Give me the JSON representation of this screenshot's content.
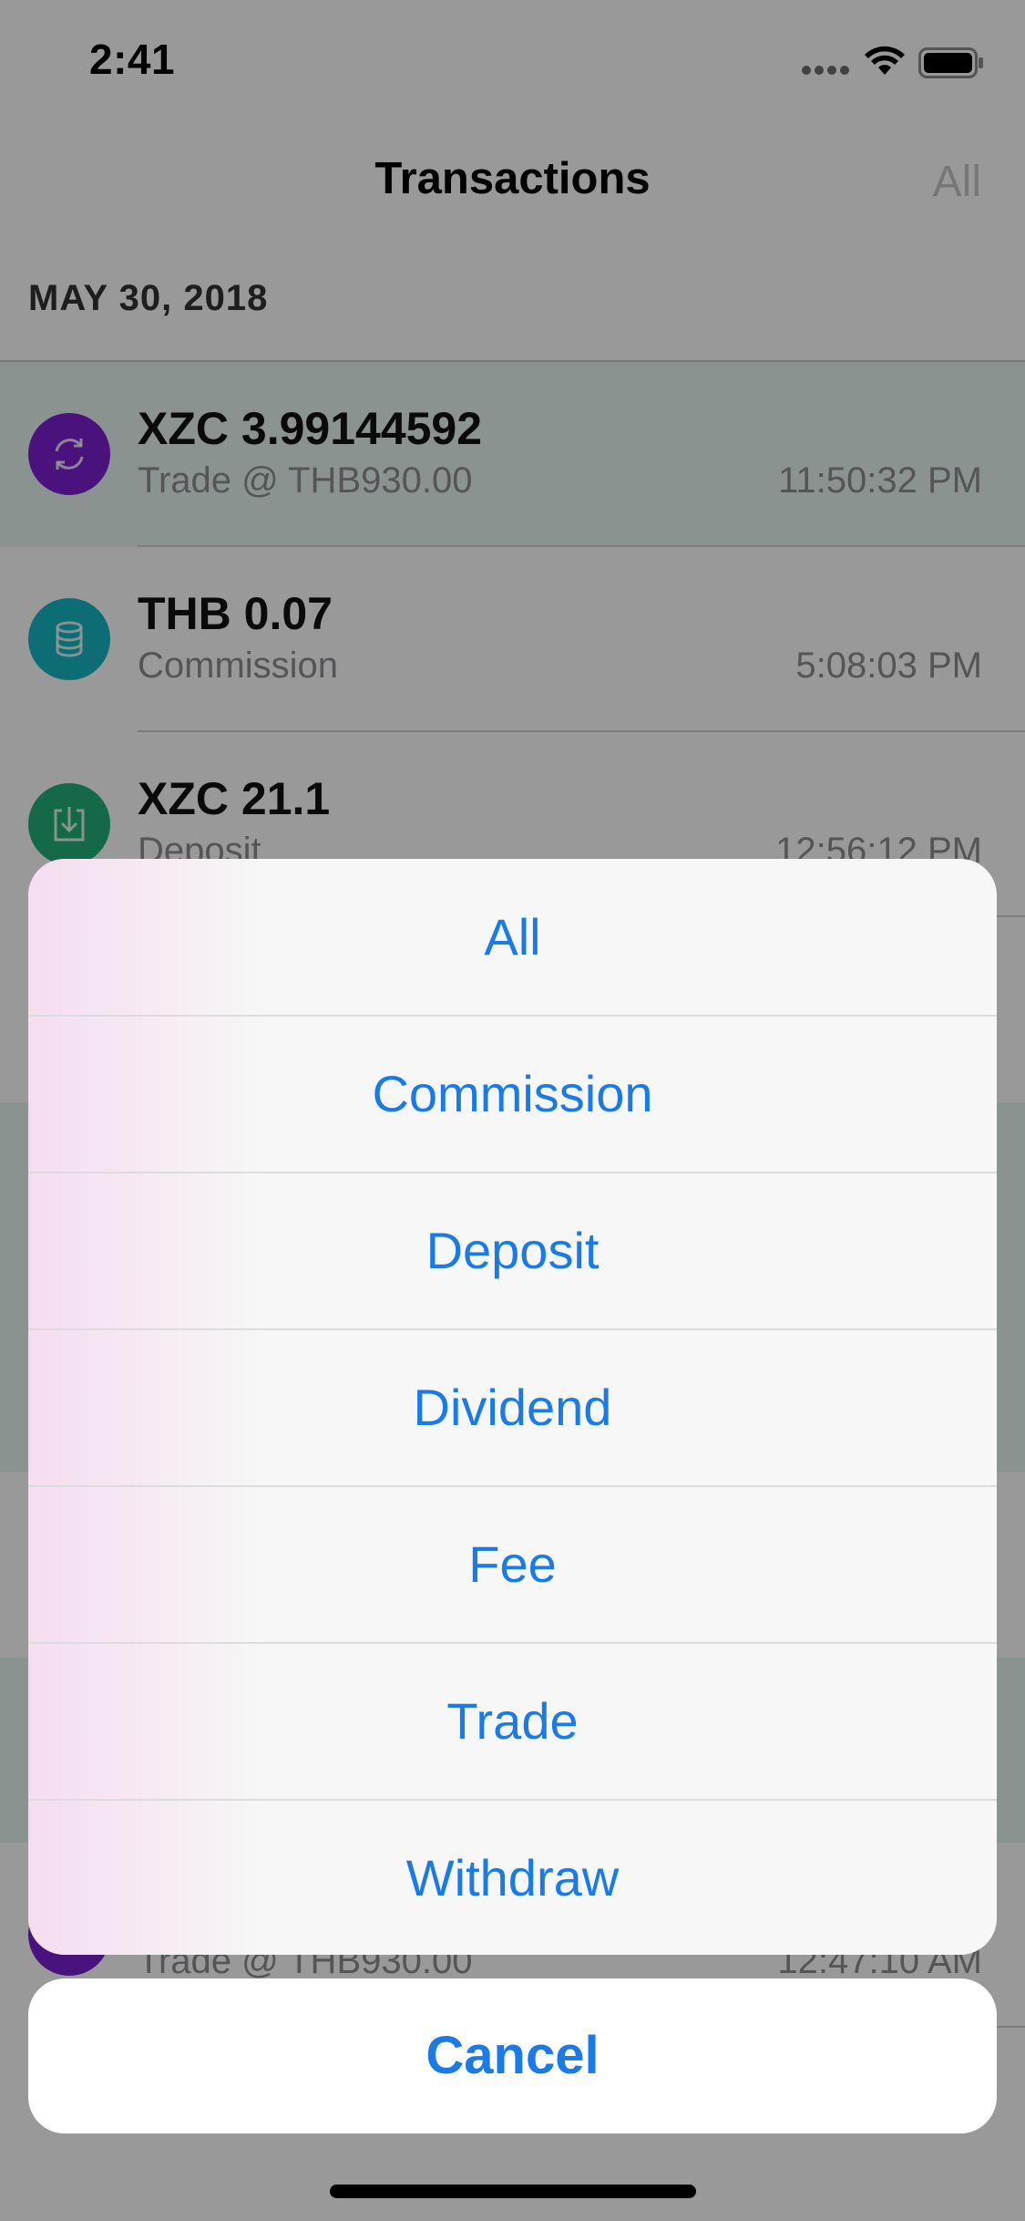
{
  "status_bar": {
    "time": "2:41"
  },
  "nav": {
    "title": "Transactions",
    "filter_label": "All"
  },
  "section": {
    "date_header": "MAY 30, 2018"
  },
  "transactions": [
    {
      "amount": "XZC 3.99144592",
      "description": "Trade @ THB930.00",
      "time": "11:50:32 PM",
      "icon": "trade-icon",
      "icon_color": "#7b1fd1"
    },
    {
      "amount": "THB 0.07",
      "description": "Commission",
      "time": "5:08:03 PM",
      "icon": "coins-icon",
      "icon_color": "#14b6c4"
    },
    {
      "amount": "XZC 21.1",
      "description": "Deposit",
      "time": "12:56:12 PM",
      "icon": "deposit-icon",
      "icon_color": "#22b07b"
    },
    {
      "amount": "",
      "description": "Trade @ THB930.00",
      "time": "12:47:10 AM",
      "icon": "trade-icon",
      "icon_color": "#7b1fd1"
    }
  ],
  "action_sheet": {
    "options": [
      "All",
      "Commission",
      "Deposit",
      "Dividend",
      "Fee",
      "Trade",
      "Withdraw"
    ],
    "cancel_label": "Cancel"
  },
  "colors": {
    "accent": "#1a7ae6"
  }
}
